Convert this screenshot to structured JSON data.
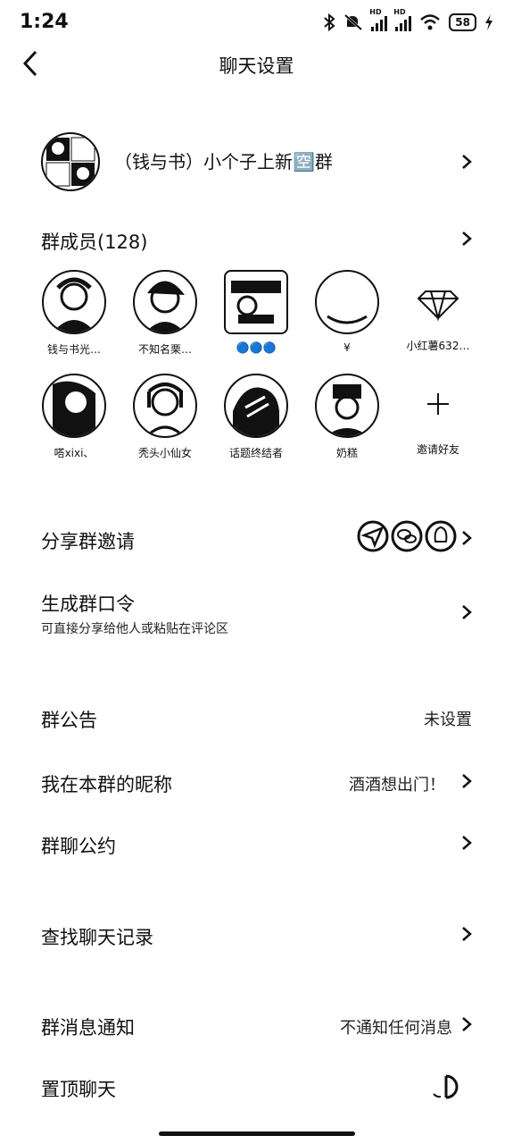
{
  "status_bar": {
    "time": "1:24",
    "battery": "58",
    "hd_label": "HD"
  },
  "header": {
    "title": "聊天设置"
  },
  "group": {
    "name": "（钱与书）小个子上新🈳群"
  },
  "members": {
    "title": "群成员(128)",
    "list": [
      {
        "name": "钱与书光…"
      },
      {
        "name": "不知名栗…"
      },
      {
        "name": "🔵🔵🔵"
      },
      {
        "name": "¥"
      },
      {
        "name": "小红薯632…"
      },
      {
        "name": "嗒xixi、"
      },
      {
        "name": "秃头小仙女"
      },
      {
        "name": "话题终结者"
      },
      {
        "name": "奶糕"
      },
      {
        "name": "邀请好友"
      }
    ]
  },
  "share": {
    "label": "分享群邀请"
  },
  "password": {
    "label": "生成群口令",
    "sub": "可直接分享给他人或粘贴在评论区"
  },
  "announcement": {
    "label": "群公告",
    "value": "未设置"
  },
  "nickname": {
    "label": "我在本群的昵称",
    "value": "酒酒想出门！"
  },
  "convention": {
    "label": "群聊公约"
  },
  "search_history": {
    "label": "查找聊天记录"
  },
  "notification": {
    "label": "群消息通知",
    "value": "不通知任何消息"
  },
  "pin": {
    "label": "置顶聊天",
    "enabled": false
  }
}
